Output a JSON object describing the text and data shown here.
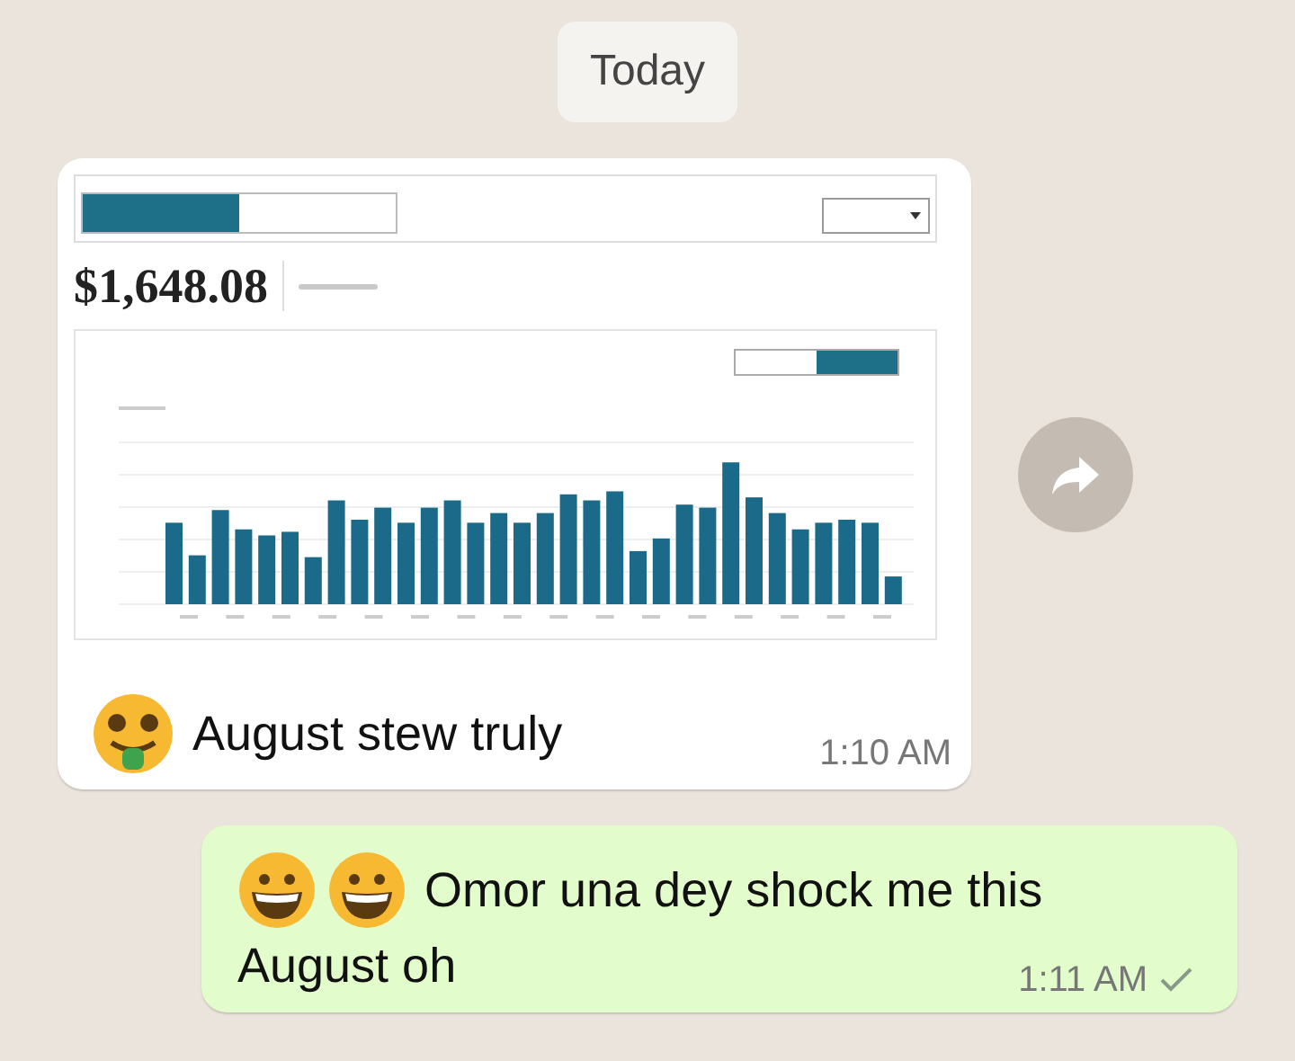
{
  "date_chip": "Today",
  "messages": [
    {
      "kind": "received",
      "attachment": {
        "kind": "dashboard_screenshot",
        "total": "$1,648.08"
      },
      "emojis": [
        {
          "kind": "money_mouth"
        }
      ],
      "text": "August stew truly",
      "time": "1:10 AM",
      "forward": true
    },
    {
      "kind": "sent",
      "emojis": [
        {
          "kind": "grin"
        },
        {
          "kind": "grin"
        }
      ],
      "text": "Omor una dey shock me this",
      "text_line_2": "August oh",
      "time": "1:11 AM",
      "read": false
    }
  ]
}
